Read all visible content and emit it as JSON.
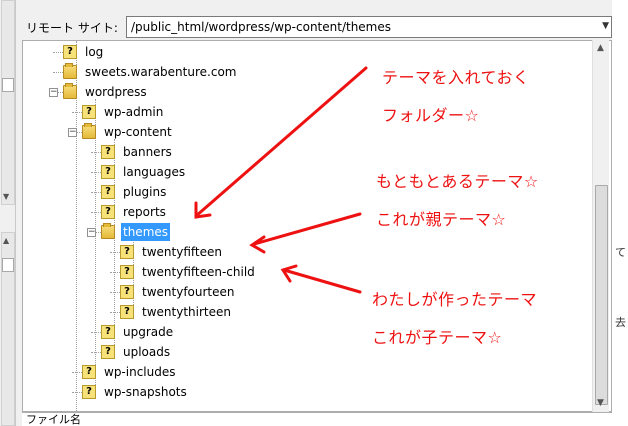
{
  "remote_site": {
    "label": "リモート サイト:",
    "path": "/public_html/wordpress/wp-content/themes"
  },
  "tree": [
    {
      "label": "log",
      "icon": "unknown-folder-icon"
    },
    {
      "label": "sweets.warabenture.com",
      "icon": "folder-icon"
    },
    {
      "label": "wordpress",
      "icon": "folder-icon",
      "expanded": true
    },
    {
      "label": "wp-admin",
      "icon": "unknown-folder-icon"
    },
    {
      "label": "wp-content",
      "icon": "folder-icon",
      "expanded": true
    },
    {
      "label": "banners",
      "icon": "unknown-folder-icon"
    },
    {
      "label": "languages",
      "icon": "unknown-folder-icon"
    },
    {
      "label": "plugins",
      "icon": "unknown-folder-icon"
    },
    {
      "label": "reports",
      "icon": "unknown-folder-icon"
    },
    {
      "label": "themes",
      "icon": "folder-icon",
      "expanded": true,
      "selected": true
    },
    {
      "label": "twentyfifteen",
      "icon": "unknown-folder-icon"
    },
    {
      "label": "twentyfifteen-child",
      "icon": "unknown-folder-icon"
    },
    {
      "label": "twentyfourteen",
      "icon": "unknown-folder-icon"
    },
    {
      "label": "twentythirteen",
      "icon": "unknown-folder-icon"
    },
    {
      "label": "upgrade",
      "icon": "unknown-folder-icon"
    },
    {
      "label": "uploads",
      "icon": "unknown-folder-icon"
    },
    {
      "label": "wp-includes",
      "icon": "unknown-folder-icon"
    },
    {
      "label": "wp-snapshots",
      "icon": "unknown-folder-icon"
    }
  ],
  "bottom_label": "ファイル名",
  "right_strip": {
    "char1": "て",
    "char2": "去"
  },
  "annotations": {
    "folder_note_1": "テーマを入れておく",
    "folder_note_2": "フォルダー☆",
    "original_note_1": "もともとあるテーマ☆",
    "original_note_2": "これが親テーマ☆",
    "child_note_1": "わたしが作ったテーマ",
    "child_note_2": "これが子テーマ☆"
  },
  "colors": {
    "annotation": "#ee1111",
    "selection": "#3399ff"
  }
}
